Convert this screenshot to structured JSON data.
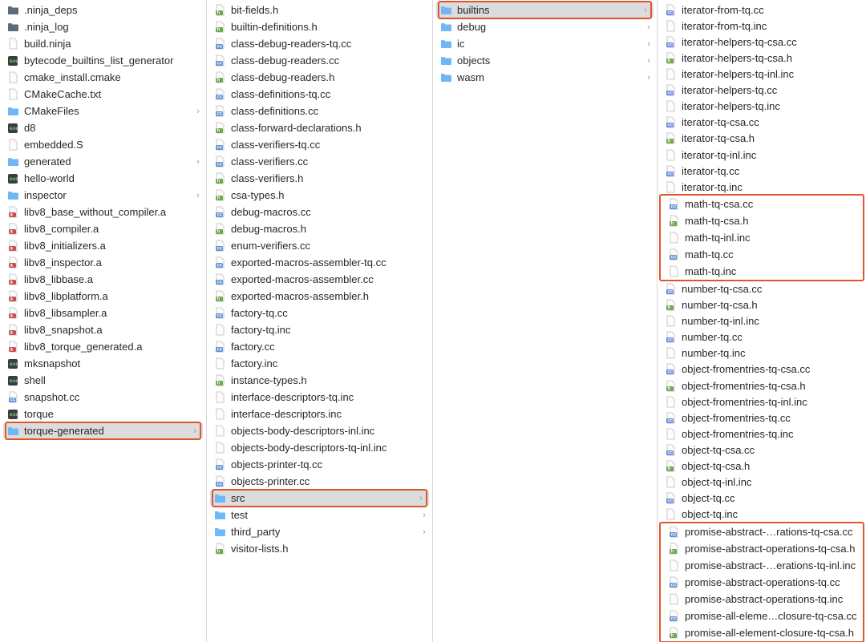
{
  "col1": [
    {
      "t": "folder-dark",
      "label": ".ninja_deps"
    },
    {
      "t": "folder-dark",
      "label": ".ninja_log"
    },
    {
      "t": "file",
      "label": "build.ninja"
    },
    {
      "t": "exec",
      "label": "bytecode_builtins_list_generator"
    },
    {
      "t": "file",
      "label": "cmake_install.cmake"
    },
    {
      "t": "file",
      "label": "CMakeCache.txt"
    },
    {
      "t": "folder",
      "label": "CMakeFiles",
      "chev": true
    },
    {
      "t": "exec",
      "label": "d8"
    },
    {
      "t": "file",
      "label": "embedded.S"
    },
    {
      "t": "folder",
      "label": "generated",
      "chev": true
    },
    {
      "t": "exec",
      "label": "hello-world"
    },
    {
      "t": "folder",
      "label": "inspector",
      "chev": true
    },
    {
      "t": "file-a",
      "label": "libv8_base_without_compiler.a"
    },
    {
      "t": "file-a",
      "label": "libv8_compiler.a"
    },
    {
      "t": "file-a",
      "label": "libv8_initializers.a"
    },
    {
      "t": "file-a",
      "label": "libv8_inspector.a"
    },
    {
      "t": "file-a",
      "label": "libv8_libbase.a"
    },
    {
      "t": "file-a",
      "label": "libv8_libplatform.a"
    },
    {
      "t": "file-a",
      "label": "libv8_libsampler.a"
    },
    {
      "t": "file-a",
      "label": "libv8_snapshot.a"
    },
    {
      "t": "file-a",
      "label": "libv8_torque_generated.a"
    },
    {
      "t": "exec",
      "label": "mksnapshot"
    },
    {
      "t": "exec",
      "label": "shell"
    },
    {
      "t": "file-cc",
      "label": "snapshot.cc"
    },
    {
      "t": "exec",
      "label": "torque"
    },
    {
      "t": "folder",
      "label": "torque-generated",
      "chev": true,
      "selected": true,
      "hl": true
    }
  ],
  "col2": [
    {
      "t": "file-h",
      "label": "bit-fields.h"
    },
    {
      "t": "file-h",
      "label": "builtin-definitions.h"
    },
    {
      "t": "file-cc",
      "label": "class-debug-readers-tq.cc"
    },
    {
      "t": "file-cc",
      "label": "class-debug-readers.cc"
    },
    {
      "t": "file-h",
      "label": "class-debug-readers.h"
    },
    {
      "t": "file-cc",
      "label": "class-definitions-tq.cc"
    },
    {
      "t": "file-cc",
      "label": "class-definitions.cc"
    },
    {
      "t": "file-h",
      "label": "class-forward-declarations.h"
    },
    {
      "t": "file-cc",
      "label": "class-verifiers-tq.cc"
    },
    {
      "t": "file-cc",
      "label": "class-verifiers.cc"
    },
    {
      "t": "file-h",
      "label": "class-verifiers.h"
    },
    {
      "t": "file-h",
      "label": "csa-types.h"
    },
    {
      "t": "file-cc",
      "label": "debug-macros.cc"
    },
    {
      "t": "file-h",
      "label": "debug-macros.h"
    },
    {
      "t": "file-cc",
      "label": "enum-verifiers.cc"
    },
    {
      "t": "file-cc",
      "label": "exported-macros-assembler-tq.cc"
    },
    {
      "t": "file-cc",
      "label": "exported-macros-assembler.cc"
    },
    {
      "t": "file-h",
      "label": "exported-macros-assembler.h"
    },
    {
      "t": "file-cc",
      "label": "factory-tq.cc"
    },
    {
      "t": "file",
      "label": "factory-tq.inc"
    },
    {
      "t": "file-cc",
      "label": "factory.cc"
    },
    {
      "t": "file",
      "label": "factory.inc"
    },
    {
      "t": "file-h",
      "label": "instance-types.h"
    },
    {
      "t": "file",
      "label": "interface-descriptors-tq.inc"
    },
    {
      "t": "file",
      "label": "interface-descriptors.inc"
    },
    {
      "t": "file",
      "label": "objects-body-descriptors-inl.inc"
    },
    {
      "t": "file",
      "label": "objects-body-descriptors-tq-inl.inc"
    },
    {
      "t": "file-cc",
      "label": "objects-printer-tq.cc"
    },
    {
      "t": "file-cc",
      "label": "objects-printer.cc"
    },
    {
      "t": "folder",
      "label": "src",
      "chev": true,
      "selected": true,
      "hl": true
    },
    {
      "t": "folder",
      "label": "test",
      "chev": true
    },
    {
      "t": "folder",
      "label": "third_party",
      "chev": true
    },
    {
      "t": "file-h",
      "label": "visitor-lists.h"
    }
  ],
  "col3": [
    {
      "t": "folder",
      "label": "builtins",
      "chev": true,
      "selected": true,
      "hl": true
    },
    {
      "t": "folder",
      "label": "debug",
      "chev": true
    },
    {
      "t": "folder",
      "label": "ic",
      "chev": true
    },
    {
      "t": "folder",
      "label": "objects",
      "chev": true
    },
    {
      "t": "folder",
      "label": "wasm",
      "chev": true
    }
  ],
  "col4_top": [
    {
      "t": "file-cc",
      "label": "iterator-from-tq.cc"
    },
    {
      "t": "file",
      "label": "iterator-from-tq.inc"
    },
    {
      "t": "file-cc",
      "label": "iterator-helpers-tq-csa.cc"
    },
    {
      "t": "file-h",
      "label": "iterator-helpers-tq-csa.h"
    },
    {
      "t": "file",
      "label": "iterator-helpers-tq-inl.inc"
    },
    {
      "t": "file-cc",
      "label": "iterator-helpers-tq.cc"
    },
    {
      "t": "file",
      "label": "iterator-helpers-tq.inc"
    },
    {
      "t": "file-cc",
      "label": "iterator-tq-csa.cc"
    },
    {
      "t": "file-h",
      "label": "iterator-tq-csa.h"
    },
    {
      "t": "file",
      "label": "iterator-tq-inl.inc"
    },
    {
      "t": "file-cc",
      "label": "iterator-tq.cc"
    },
    {
      "t": "file",
      "label": "iterator-tq.inc"
    }
  ],
  "col4_group1": [
    {
      "t": "file-cc",
      "label": "math-tq-csa.cc"
    },
    {
      "t": "file-h",
      "label": "math-tq-csa.h"
    },
    {
      "t": "file",
      "label": "math-tq-inl.inc"
    },
    {
      "t": "file-cc",
      "label": "math-tq.cc"
    },
    {
      "t": "file",
      "label": "math-tq.inc"
    }
  ],
  "col4_mid": [
    {
      "t": "file-cc",
      "label": "number-tq-csa.cc"
    },
    {
      "t": "file-h",
      "label": "number-tq-csa.h"
    },
    {
      "t": "file",
      "label": "number-tq-inl.inc"
    },
    {
      "t": "file-cc",
      "label": "number-tq.cc"
    },
    {
      "t": "file",
      "label": "number-tq.inc"
    },
    {
      "t": "file-cc",
      "label": "object-fromentries-tq-csa.cc"
    },
    {
      "t": "file-h",
      "label": "object-fromentries-tq-csa.h"
    },
    {
      "t": "file",
      "label": "object-fromentries-tq-inl.inc"
    },
    {
      "t": "file-cc",
      "label": "object-fromentries-tq.cc"
    },
    {
      "t": "file",
      "label": "object-fromentries-tq.inc"
    },
    {
      "t": "file-cc",
      "label": "object-tq-csa.cc"
    },
    {
      "t": "file-h",
      "label": "object-tq-csa.h"
    },
    {
      "t": "file",
      "label": "object-tq-inl.inc"
    },
    {
      "t": "file-cc",
      "label": "object-tq.cc"
    },
    {
      "t": "file",
      "label": "object-tq.inc"
    }
  ],
  "col4_group2": [
    {
      "t": "file-cc",
      "label": "promise-abstract-…rations-tq-csa.cc"
    },
    {
      "t": "file-h",
      "label": "promise-abstract-operations-tq-csa.h"
    },
    {
      "t": "file",
      "label": "promise-abstract-…erations-tq-inl.inc"
    },
    {
      "t": "file-cc",
      "label": "promise-abstract-operations-tq.cc"
    },
    {
      "t": "file",
      "label": "promise-abstract-operations-tq.inc"
    },
    {
      "t": "file-cc",
      "label": "promise-all-eleme…closure-tq-csa.cc"
    },
    {
      "t": "file-h",
      "label": "promise-all-element-closure-tq-csa.h"
    }
  ]
}
